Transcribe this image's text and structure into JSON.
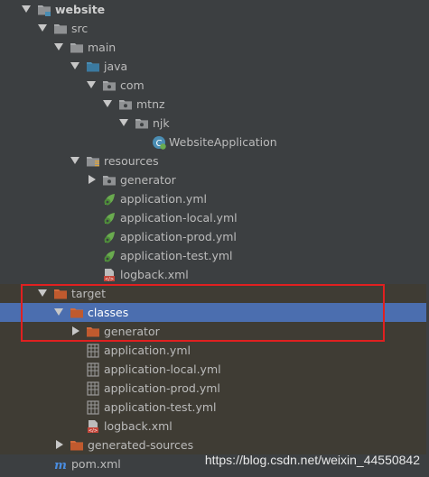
{
  "tree": {
    "website": "website",
    "src": "src",
    "main": "main",
    "java": "java",
    "com": "com",
    "mtnz": "mtnz",
    "njk": "njk",
    "website_application": "WebsiteApplication",
    "resources": "resources",
    "res_generator": "generator",
    "res_application_yml": "application.yml",
    "res_application_local_yml": "application-local.yml",
    "res_application_prod_yml": "application-prod.yml",
    "res_application_test_yml": "application-test.yml",
    "res_logback_xml": "logback.xml",
    "target": "target",
    "classes": "classes",
    "classes_generator": "generator",
    "cls_application_yml": "application.yml",
    "cls_application_local_yml": "application-local.yml",
    "cls_application_prod_yml": "application-prod.yml",
    "cls_application_test_yml": "application-test.yml",
    "cls_logback_xml": "logback.xml",
    "generated_sources": "generated-sources",
    "pom_xml": "pom.xml"
  },
  "watermark": "https://blog.csdn.net/weixin_44550842",
  "colors": {
    "background": "#3c3f41",
    "selection": "#4b6eaf",
    "excluded_folder": "#3f3c34",
    "highlight_box": "#e02020"
  },
  "icons": {
    "folder": "folder-icon",
    "source_folder": "source-folder-icon",
    "resources_folder": "resources-folder-icon",
    "excluded_folder": "excluded-folder-icon",
    "spring_class": "spring-boot-class-icon",
    "spring_config": "spring-config-yml-icon",
    "yml_file": "yml-file-icon",
    "xml_file": "xml-file-icon",
    "maven": "maven-icon",
    "module": "module-folder-icon"
  }
}
